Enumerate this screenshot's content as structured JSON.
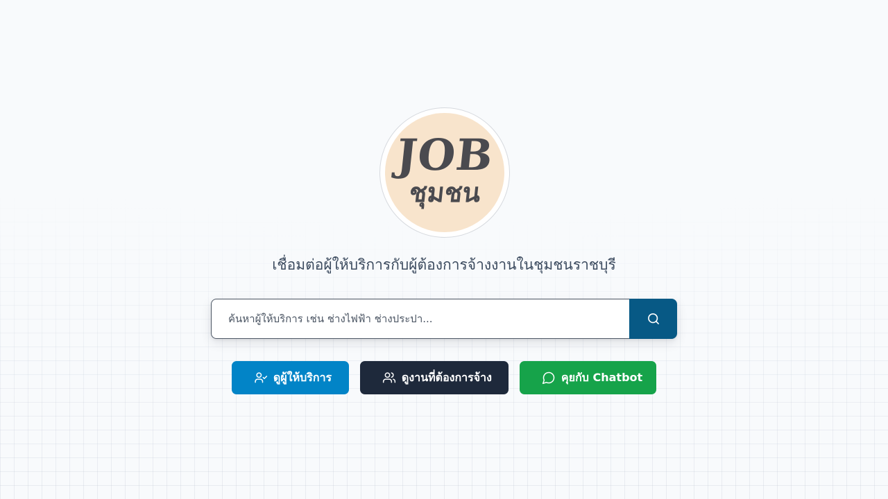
{
  "logo": {
    "line1": "JOB",
    "line2": "ชุมชน",
    "circle_color": "#f8e4cc",
    "text_color": "#4a4a4f"
  },
  "tagline": "เชื่อมต่อผู้ให้บริการกับผู้ต้องการจ้างงานในชุมชนราชบุรี",
  "search": {
    "placeholder": "ค้นหาผู้ให้บริการ เช่น ช่างไฟฟ้า ช่างประปา...",
    "value": "",
    "button_icon": "search-icon",
    "button_color": "#075985"
  },
  "actions": [
    {
      "label": "ดูผู้ให้บริการ",
      "icon": "user-check-icon",
      "color": "#0284c7"
    },
    {
      "label": "ดูงานที่ต้องการจ้าง",
      "icon": "users-icon",
      "color": "#1e293b"
    },
    {
      "label": "คุยกับ Chatbot",
      "icon": "message-circle-icon",
      "color": "#16a34a"
    }
  ]
}
